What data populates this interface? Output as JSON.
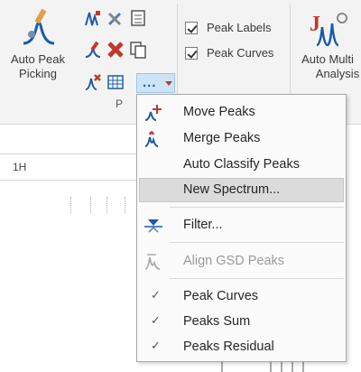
{
  "ribbon": {
    "auto_peak_picking": {
      "label_line1": "Auto Peak",
      "label_line2": "Picking"
    },
    "more_button": {
      "label": "...",
      "icon": "more-dots-icon"
    },
    "group_label": "P",
    "checkboxes": [
      {
        "label": "Peak Labels",
        "checked": true
      },
      {
        "label": "Peak Curves",
        "checked": true
      }
    ],
    "auto_multi": {
      "label_line1": "Auto Multi",
      "label_line2": "Analysis"
    }
  },
  "document": {
    "nucleus_label": "1H"
  },
  "menu": {
    "items": [
      {
        "label": "Move Peaks",
        "icon": "move-peaks-icon",
        "enabled": true
      },
      {
        "label": "Merge Peaks",
        "icon": "merge-peaks-icon",
        "enabled": true
      },
      {
        "label": "Auto Classify Peaks",
        "icon": "",
        "enabled": true
      },
      {
        "label": "New Spectrum...",
        "icon": "",
        "enabled": true,
        "highlighted": true
      },
      {
        "label": "Filter...",
        "icon": "filter-icon",
        "enabled": true
      },
      {
        "label": "Align GSD Peaks",
        "icon": "align-peaks-icon",
        "enabled": false
      },
      {
        "label": "Peak Curves",
        "checked": true,
        "enabled": true
      },
      {
        "label": "Peaks Sum",
        "checked": true,
        "enabled": true
      },
      {
        "label": "Peaks Residual",
        "checked": true,
        "enabled": true
      }
    ]
  },
  "colors": {
    "accent_blue": "#1b5aa8",
    "accent_red": "#c0392b",
    "menu_highlight": "#dbdbdb"
  }
}
